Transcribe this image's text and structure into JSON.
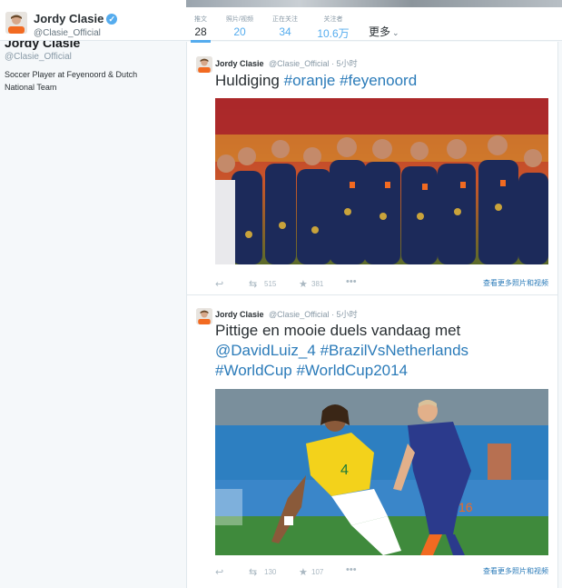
{
  "header": {
    "name": "Jordy Clasie",
    "handle": "@Clasie_Official",
    "stats": [
      {
        "label": "推文",
        "value": "28"
      },
      {
        "label": "照片/视频",
        "value": "20"
      },
      {
        "label": "正在关注",
        "value": "34"
      },
      {
        "label": "关注者",
        "value": "10.6万"
      }
    ],
    "more_label": "更多"
  },
  "sidebar": {
    "name": "Jordy Clasie",
    "handle": "@Clasie_Official",
    "bio": "Soccer Player at Feyenoord & Dutch National Team"
  },
  "tweets": [
    {
      "name": "Jordy Clasie",
      "handle": "@Clasie_Official",
      "time": "· 5小时",
      "text_plain": "Huldiging",
      "hashtags": [
        "#oranje",
        "#feyenoord"
      ],
      "retweets": "515",
      "favorites": "381",
      "more_media": "查看更多照片和视频"
    },
    {
      "name": "Jordy Clasie",
      "handle": "@Clasie_Official",
      "time": "· 5小时",
      "line1": "Pittige en mooie duels vandaag met",
      "mention": "@DavidLuiz_4",
      "tag1": "#BrazilVsNetherlands",
      "tag2": "#WorldCup",
      "tag3": "#WorldCup2014",
      "jersey_4": "4",
      "jersey_16": "16",
      "retweets": "130",
      "favorites": "107",
      "more_media": "查看更多照片和视频"
    }
  ],
  "colors": {
    "link": "#2b7bb9",
    "stat": "#55acee",
    "orange_kit": "#2b3a8c",
    "brazil_yellow": "#f3d21b"
  }
}
